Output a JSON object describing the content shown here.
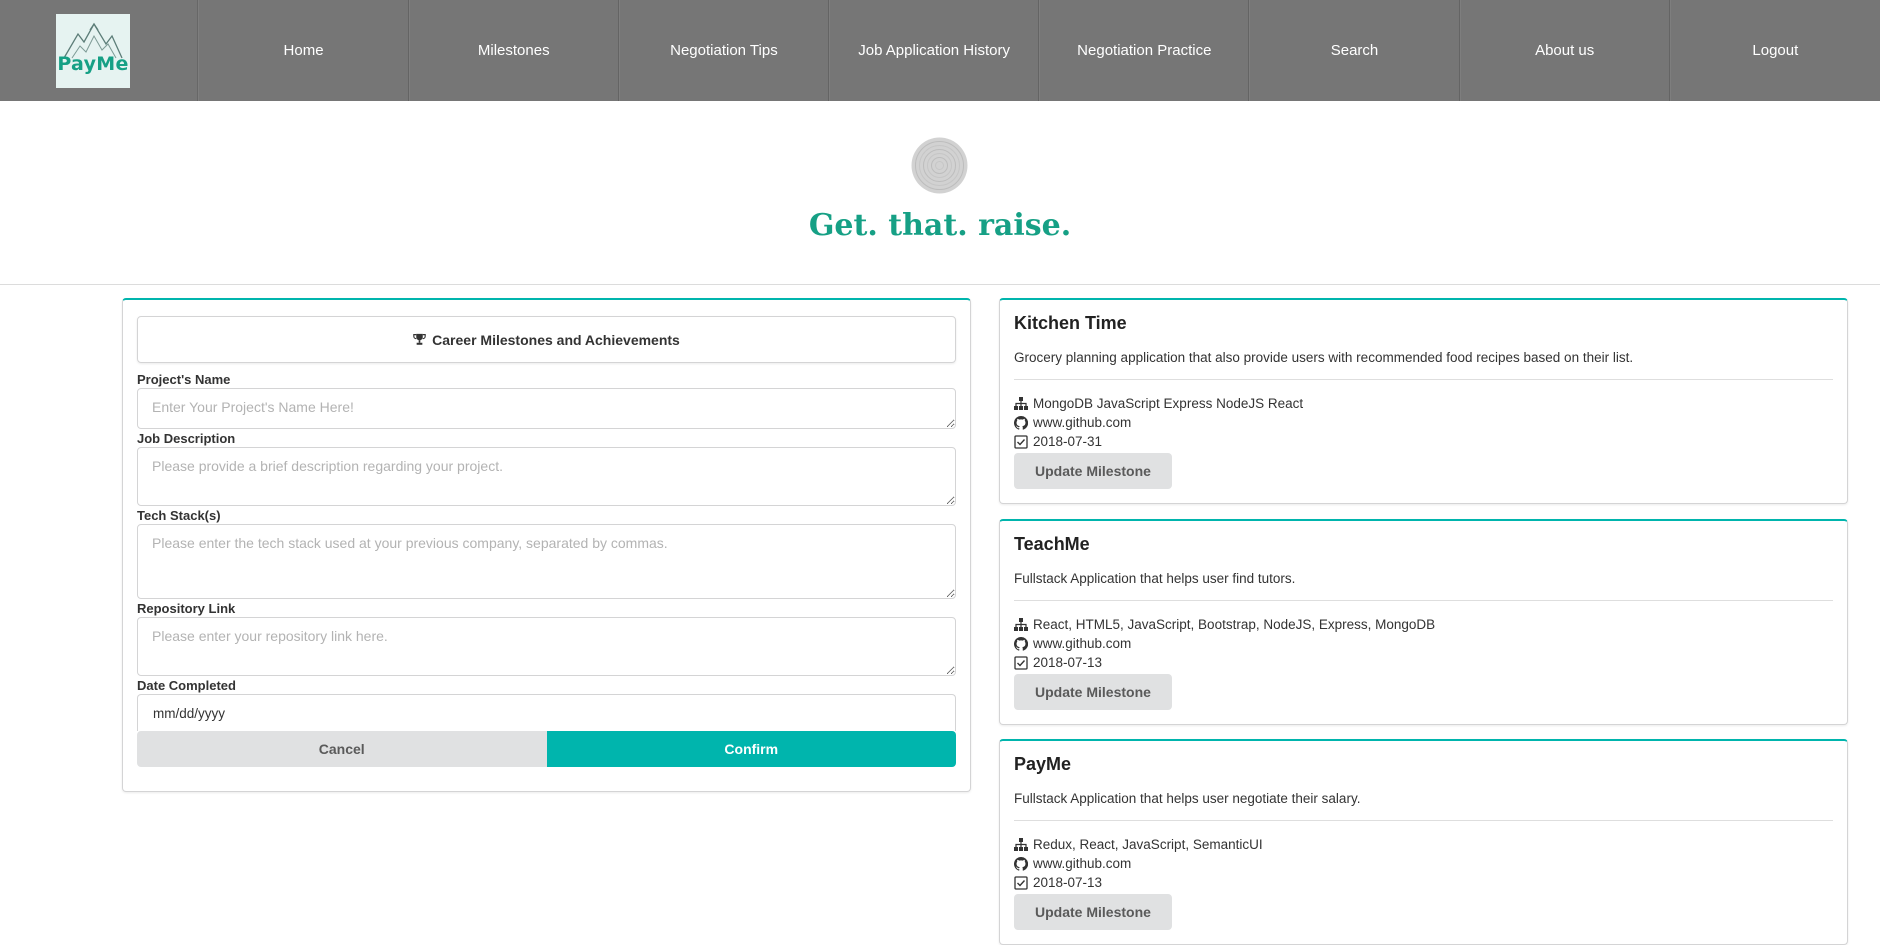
{
  "nav": {
    "logo_text": "PayMe",
    "items": [
      {
        "label": "Home"
      },
      {
        "label": "Milestones"
      },
      {
        "label": "Negotiation Tips"
      },
      {
        "label": "Job Application History"
      },
      {
        "label": "Negotiation Practice"
      },
      {
        "label": "Search"
      },
      {
        "label": "About us"
      },
      {
        "label": "Logout"
      }
    ]
  },
  "hero": {
    "tagline": "Get. that. raise."
  },
  "form": {
    "header": "Career Milestones and Achievements",
    "fields": {
      "project_name": {
        "label": "Project's Name",
        "placeholder": "Enter Your Project's Name Here!",
        "value": ""
      },
      "job_description": {
        "label": "Job Description",
        "placeholder": "Please provide a brief description regarding your project.",
        "value": ""
      },
      "tech_stack": {
        "label": "Tech Stack(s)",
        "placeholder": "Please enter the tech stack used at your previous company, separated by commas.",
        "value": ""
      },
      "repository": {
        "label": "Repository Link",
        "placeholder": "Please enter your repository link here.",
        "value": ""
      },
      "date": {
        "label": "Date Completed",
        "placeholder": "mm/dd/yyyy"
      }
    },
    "cancel_label": "Cancel",
    "confirm_label": "Confirm"
  },
  "milestones": [
    {
      "title": "Kitchen Time",
      "description": "Grocery planning application that also provide users with recommended food recipes based on their list.",
      "tech": "MongoDB JavaScript Express NodeJS React",
      "repo": "www.github.com",
      "date": "2018-07-31",
      "button": "Update Milestone"
    },
    {
      "title": "TeachMe",
      "description": "Fullstack Application that helps user find tutors.",
      "tech": "React, HTML5, JavaScript, Bootstrap, NodeJS, Express, MongoDB",
      "repo": "www.github.com",
      "date": "2018-07-13",
      "button": "Update Milestone"
    },
    {
      "title": "PayMe",
      "description": "Fullstack Application that helps user negotiate their salary.",
      "tech": "Redux, React, JavaScript, SemanticUI",
      "repo": "www.github.com",
      "date": "2018-07-13",
      "button": "Update Milestone"
    }
  ],
  "colors": {
    "nav_bg": "#767676",
    "accent": "#00b5ad",
    "brand_green": "#16a085",
    "button_grey": "#e0e1e2"
  },
  "icons": {
    "form_header": "trophy-icon",
    "tech": "sitemap-icon",
    "repo": "github-icon",
    "date": "check-square-icon",
    "loader": "spinner-icon"
  }
}
